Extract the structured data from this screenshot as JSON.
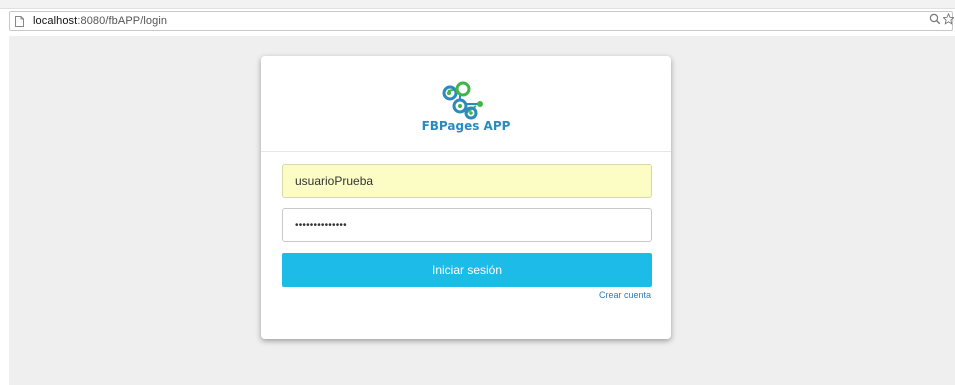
{
  "browser": {
    "url_host": "localhost",
    "url_path": ":8080/fbAPP/login"
  },
  "login": {
    "app_name": "FBPages APP",
    "username_value": "usuarioPrueba",
    "password_value": "••••••••••••••",
    "submit_label": "Iniciar sesión",
    "create_account_label": "Crear cuenta"
  },
  "colors": {
    "accent": "#1dbbe8",
    "autofill": "#fbfdc5",
    "logo_blue": "#2a8bbd",
    "logo_green": "#3fb54a"
  }
}
